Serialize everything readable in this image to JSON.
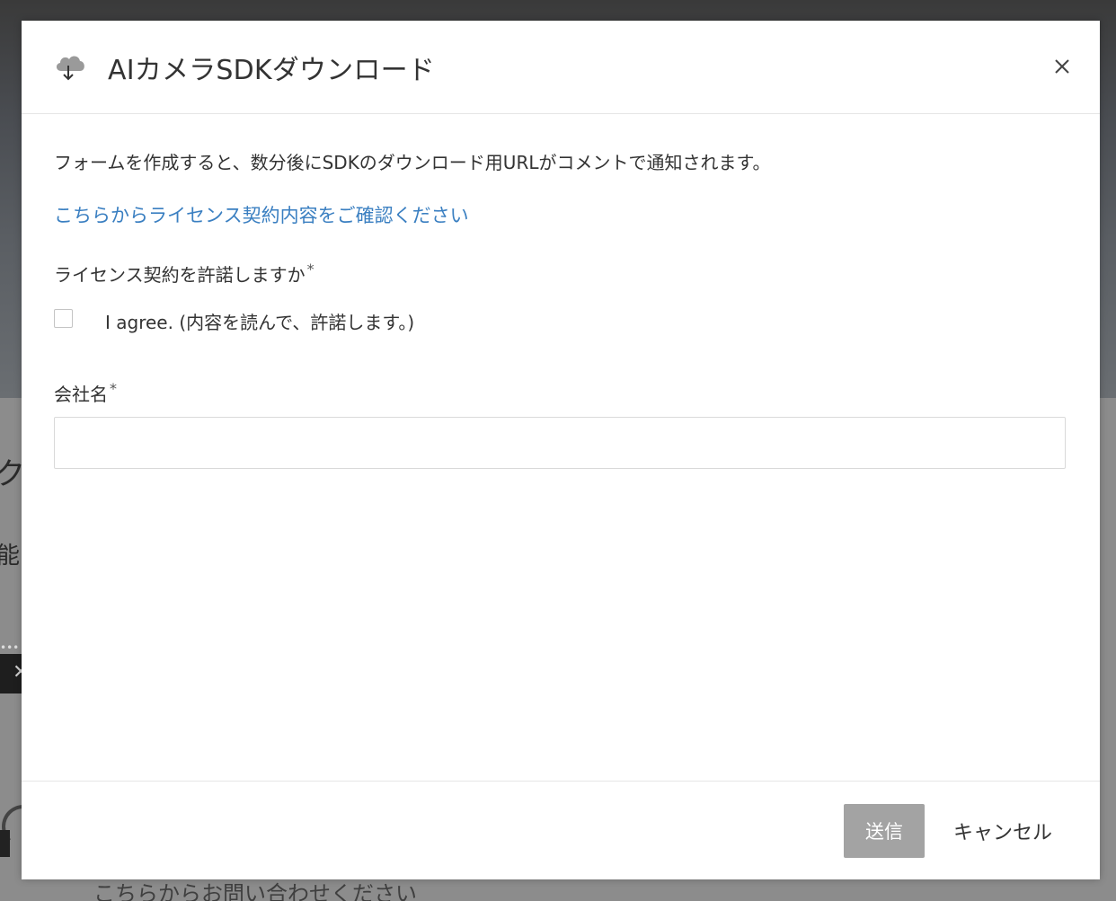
{
  "background": {
    "heading_fragment": "ク",
    "text_fragment": "能",
    "contact_text": "こちらからお問い合わせください"
  },
  "dialog": {
    "title": "AIカメラSDKダウンロード",
    "header_icon": "cloud-download-icon",
    "close_icon": "close-icon",
    "intro": "フォームを作成すると、数分後にSDKのダウンロード用URLがコメントで通知されます。",
    "license_link": "こちらからライセンス契約内容をご確認ください",
    "agreement": {
      "label": "ライセンス契約を許諾しますか",
      "required_mark": "*",
      "checkbox_text": "I agree. (内容を読んで、許諾します。)",
      "checked": false
    },
    "company": {
      "label": "会社名",
      "required_mark": "*",
      "value": "",
      "placeholder": ""
    },
    "footer": {
      "submit_label": "送信",
      "cancel_label": "キャンセル"
    },
    "colors": {
      "link": "#3a7fc1",
      "submit_disabled": "#a3a3a3"
    }
  }
}
